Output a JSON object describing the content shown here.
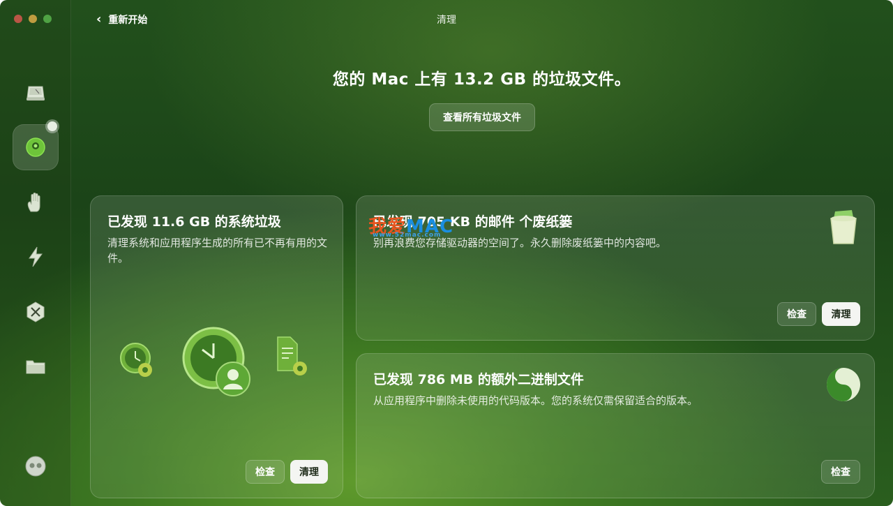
{
  "window": {
    "title": "清理"
  },
  "nav": {
    "back_label": "重新开始"
  },
  "sidebar": {
    "items": [
      {
        "icon": "disk-icon"
      },
      {
        "icon": "cleanup-icon",
        "active": true
      },
      {
        "icon": "hand-icon"
      },
      {
        "icon": "speed-icon"
      },
      {
        "icon": "applications-icon"
      },
      {
        "icon": "folder-icon"
      }
    ],
    "bottom_icon": "assistant-icon"
  },
  "header": {
    "headline": "您的 Mac 上有 13.2 GB 的垃圾文件。",
    "view_all_label": "查看所有垃圾文件"
  },
  "cards": {
    "system": {
      "title": "已发现 11.6 GB 的系统垃圾",
      "description": "清理系统和应用程序生成的所有已不再有用的文件。",
      "review_label": "检查",
      "clean_label": "清理"
    },
    "mail": {
      "title": "已发现 705 KB 的邮件 个废纸篓",
      "description": "别再浪费您存储驱动器的空间了。永久删除废纸篓中的内容吧。",
      "review_label": "检查",
      "clean_label": "清理"
    },
    "binaries": {
      "title": "已发现 786 MB 的额外二进制文件",
      "description": "从应用程序中删除未使用的代码版本。您的系统仅需保留适合的版本。",
      "review_label": "检查"
    }
  },
  "watermark": {
    "part1": "我爱",
    "part2": "MAC",
    "sub": "www.52mac.com"
  },
  "colors": {
    "accent_green": "#5da82b",
    "button_light": "#f4f5f2"
  }
}
